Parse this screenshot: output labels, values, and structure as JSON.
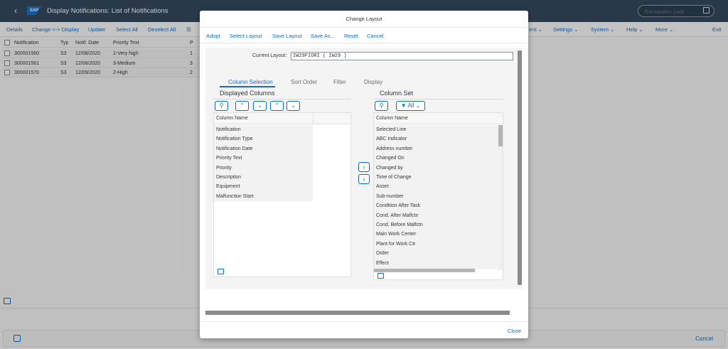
{
  "shell": {
    "back_icon": "back-chevron",
    "logo": "SAP",
    "title": "Display Notifications: List of Notifications",
    "transaction_placeholder": "Transaction code"
  },
  "toolbar": {
    "details": "Details",
    "change_display": "Change <-> Display",
    "update": "Update",
    "select_all": "Select All",
    "deselect_all": "Deselect All",
    "environment": "ent",
    "settings": "Settings",
    "system": "System",
    "help": "Help",
    "more": "More",
    "exit": "Exit"
  },
  "grid": {
    "columns": [
      "Notification",
      "Typ",
      "Notif. Date",
      "Priority Text",
      "P"
    ],
    "rows": [
      [
        "300001560",
        "S3",
        "12/08/2020",
        "1-Very high",
        "1"
      ],
      [
        "300001561",
        "S3",
        "12/08/2020",
        "3-Medium",
        "3"
      ],
      [
        "300001570",
        "S3",
        "12/09/2020",
        "2-High",
        "2"
      ]
    ]
  },
  "footer": {
    "cancel": "Cancel"
  },
  "dialog": {
    "title": "Change Layout",
    "toolbar": {
      "adopt": "Adopt",
      "select_layout": "Select Layout",
      "save_layout": "Save Layout",
      "save_as": "Save As...",
      "reset": "Reset",
      "cancel": "Cancel"
    },
    "current_layout_label": "Current Layout:",
    "current_layout_value": "IW29FIORI ( IW29 )",
    "tabs": [
      "Column Selection",
      "Sort Order",
      "Filter",
      "Display"
    ],
    "displayed": {
      "title": "Displayed Columns",
      "header": "Column Name",
      "items": [
        "Notification",
        "Notification Type",
        "Notification Date",
        "Priority Text",
        "Priority",
        "Description",
        "Equipment",
        "Malfunction Start"
      ]
    },
    "column_set": {
      "title": "Column Set",
      "filter_label": "All",
      "header": "Column Name",
      "items": [
        "Selected Line",
        "ABC Indicator",
        "Address number",
        "Changed On",
        "Changed by",
        "Time of Change",
        "Asset",
        "Sub-number",
        "Condition After Task",
        "Cond. After Malfctn",
        "Cond. Before Malfctn",
        "Main Work Center",
        "Plant for Work Ctr",
        "Order",
        "Effect"
      ]
    },
    "close": "Close"
  },
  "colors": {
    "shell": "#354a5f",
    "accent": "#0a6ed1"
  }
}
